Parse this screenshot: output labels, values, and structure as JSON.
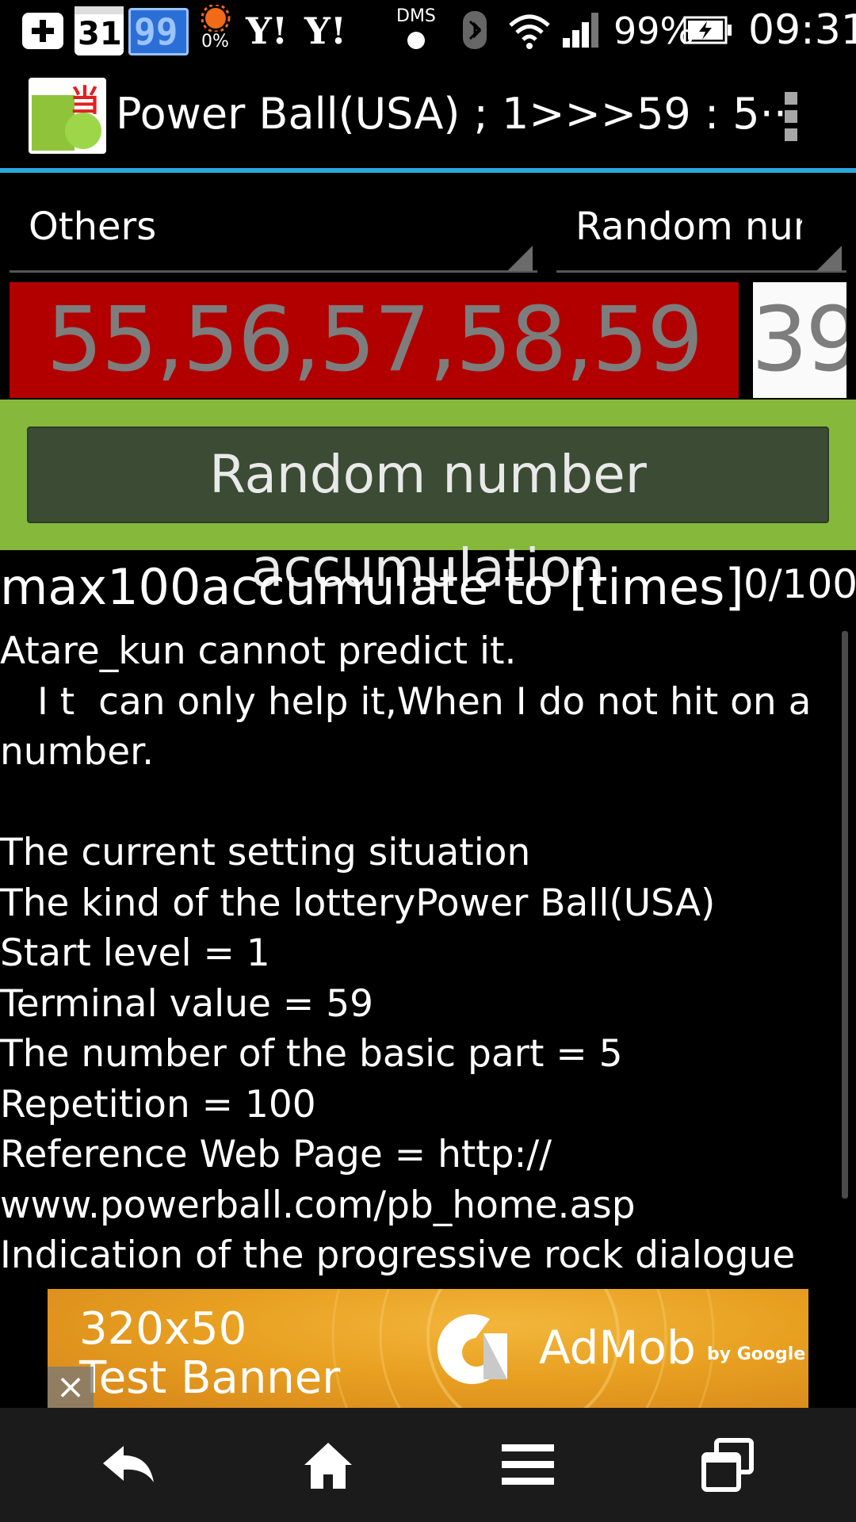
{
  "status_bar": {
    "calendar_day": "31",
    "counter": "99",
    "percent_small": "0%",
    "yahoo_1": "Y!",
    "yahoo_2": "Y!",
    "dms": "DMS",
    "battery_percent": "99%",
    "time": "09:31"
  },
  "action_bar": {
    "title": "Power Ball(USA) ; 1>>>59 : 5···",
    "app_icon_char": "当"
  },
  "spinners": {
    "left_value": "Others",
    "right_value": "Random num"
  },
  "result": {
    "numbers": "55,56,57,58,59",
    "count": "39"
  },
  "button": {
    "accumulate_label": "Random number accumulation"
  },
  "accumulate": {
    "label": "max100accumulate to [times]",
    "progress": "0/100"
  },
  "info_text": "Atare_kun cannot predict it.\n　I t  can only help it,When I do not hit on a number.\n\nThe current setting situation\nThe kind of the lotteryPower Ball(USA)\nStart level = 1\nTerminal value = 59\nThe number of the basic part = 5\nRepetition = 100\nReference Web Page = http://\nwww.powerball.com/pb_home.asp\nIndication of the progressive rock dialogue\n=Yes",
  "ad": {
    "size_label": "320x50",
    "test_label": "Test Banner",
    "brand": "AdMob",
    "by": "by Google",
    "close": "×"
  },
  "colors": {
    "accent": "#2aa7dd",
    "result_bg": "#b20000",
    "band_green": "#86b83c",
    "button_bg": "#3c4b34"
  }
}
